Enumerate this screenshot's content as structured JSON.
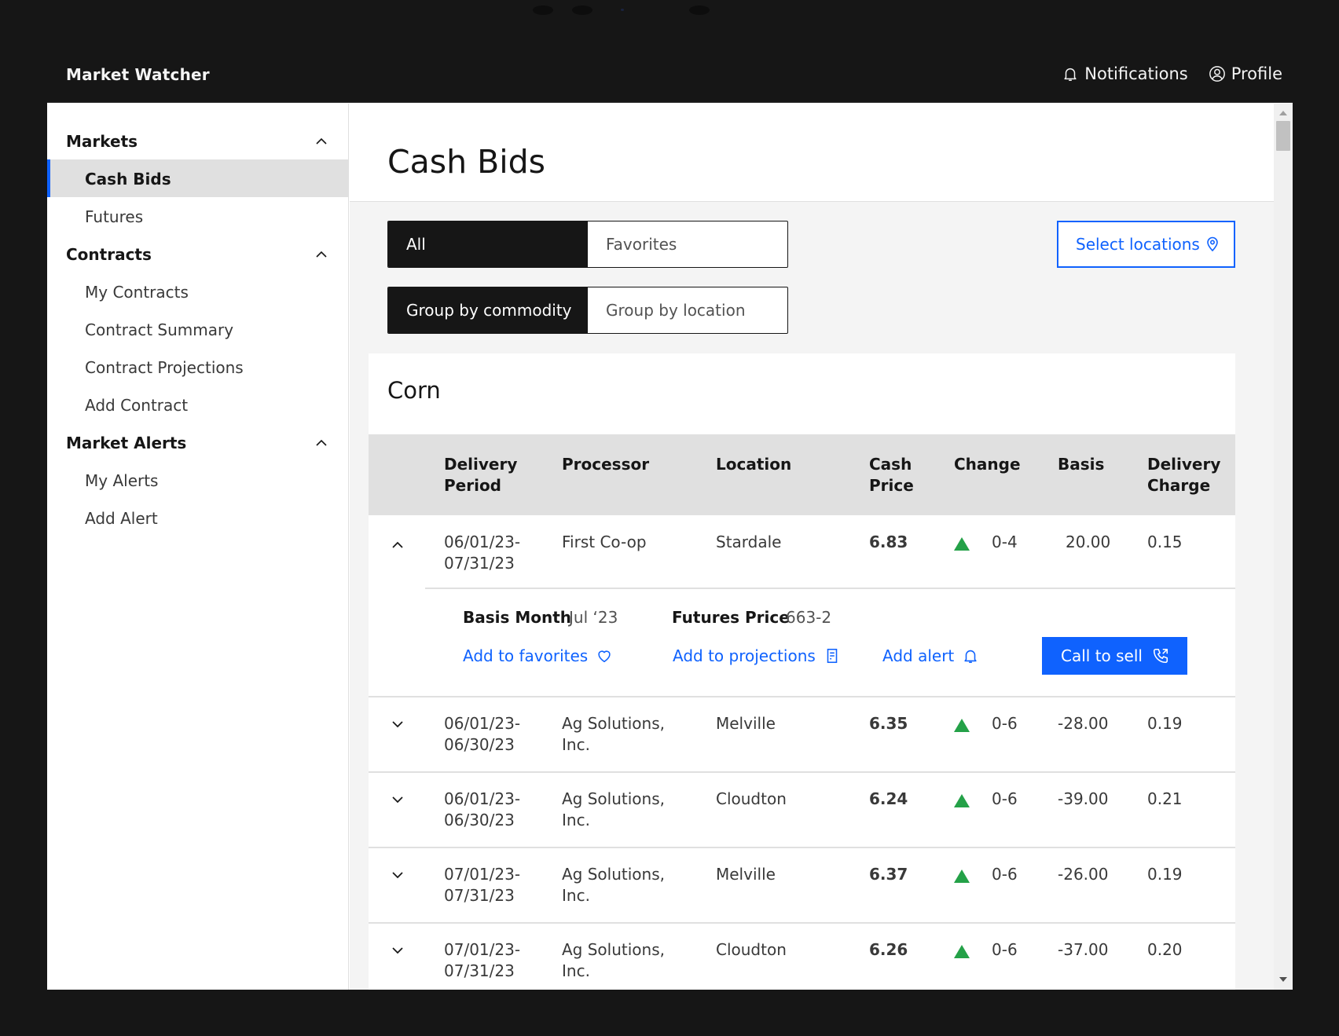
{
  "app": {
    "name": "Market Watcher",
    "notifications_label": "Notifications",
    "profile_label": "Profile"
  },
  "sidebar": {
    "sections": [
      {
        "label": "Markets",
        "items": [
          {
            "label": "Cash Bids",
            "active": true
          },
          {
            "label": "Futures"
          }
        ]
      },
      {
        "label": "Contracts",
        "items": [
          {
            "label": "My Contracts"
          },
          {
            "label": "Contract Summary"
          },
          {
            "label": "Contract Projections"
          },
          {
            "label": "Add Contract"
          }
        ]
      },
      {
        "label": "Market Alerts",
        "items": [
          {
            "label": "My Alerts"
          },
          {
            "label": "Add Alert"
          }
        ]
      }
    ]
  },
  "page": {
    "title": "Cash Bids",
    "filter_toggle": {
      "options": [
        "All",
        "Favorites"
      ],
      "selected": "All"
    },
    "group_toggle": {
      "options": [
        "Group by commodity",
        "Group by location"
      ],
      "selected": "Group by commodity"
    },
    "select_locations_label": "Select locations"
  },
  "commodity": {
    "name": "Corn",
    "columns": {
      "delivery_period": [
        "Delivery",
        "Period"
      ],
      "processor": [
        "Processor"
      ],
      "location": [
        "Location"
      ],
      "cash_price": [
        "Cash",
        "Price"
      ],
      "change": [
        "Change"
      ],
      "basis": [
        "Basis"
      ],
      "delivery_charge": [
        "Delivery",
        "Charge"
      ]
    },
    "rows": [
      {
        "period": [
          "06/01/23-",
          "07/31/23"
        ],
        "processor": [
          "First Co-op"
        ],
        "location": "Stardale",
        "cash_price": "6.83",
        "change": "0-4",
        "basis": "20.00",
        "delivery_charge": "0.15",
        "expanded": true
      },
      {
        "period": [
          "06/01/23-",
          "06/30/23"
        ],
        "processor": [
          "Ag Solutions,",
          "Inc."
        ],
        "location": "Melville",
        "cash_price": "6.35",
        "change": "0-6",
        "basis": "-28.00",
        "delivery_charge": "0.19"
      },
      {
        "period": [
          "06/01/23-",
          "06/30/23"
        ],
        "processor": [
          "Ag Solutions,",
          "Inc."
        ],
        "location": "Cloudton",
        "cash_price": "6.24",
        "change": "0-6",
        "basis": "-39.00",
        "delivery_charge": "0.21"
      },
      {
        "period": [
          "07/01/23-",
          "07/31/23"
        ],
        "processor": [
          "Ag Solutions,",
          "Inc."
        ],
        "location": "Melville",
        "cash_price": "6.37",
        "change": "0-6",
        "basis": "-26.00",
        "delivery_charge": "0.19"
      },
      {
        "period": [
          "07/01/23-",
          "07/31/23"
        ],
        "processor": [
          "Ag Solutions,",
          "Inc."
        ],
        "location": "Cloudton",
        "cash_price": "6.26",
        "change": "0-6",
        "basis": "-37.00",
        "delivery_charge": "0.20"
      }
    ],
    "detail": {
      "basis_month_label": "Basis Month",
      "basis_month_value": "Jul ‘23",
      "futures_price_label": "Futures Price",
      "futures_price_value": "663-2",
      "add_favorites_label": "Add to favorites",
      "add_projections_label": "Add to projections",
      "add_alert_label": "Add alert",
      "call_to_sell_label": "Call to sell"
    }
  },
  "colors": {
    "accent": "#0f62fe",
    "positive_change": "#24a148",
    "header_bg": "#161616"
  },
  "icons": {
    "notifications": "bell-icon",
    "profile": "user-avatar-icon",
    "location": "location-pin-icon",
    "favorite": "heart-icon",
    "projections": "document-icon",
    "alert": "bell-icon",
    "call": "phone-icon",
    "expand": "chevron-down-icon",
    "collapse": "chevron-up-icon",
    "change_up": "triangle-up-icon"
  }
}
